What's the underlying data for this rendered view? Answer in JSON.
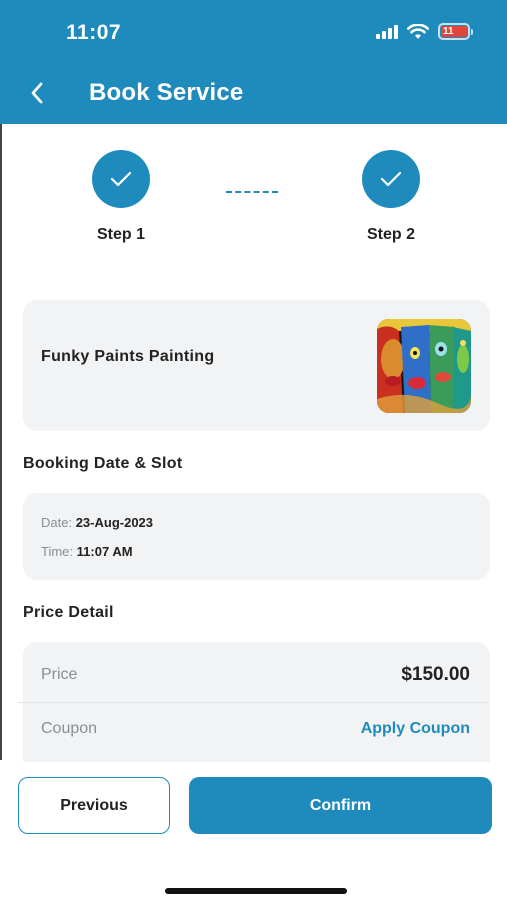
{
  "status_bar": {
    "time": "11:07",
    "battery_level": "11",
    "icons": [
      "signal-icon",
      "wifi-icon",
      "battery-icon"
    ]
  },
  "header": {
    "title": "Book Service",
    "back_icon": "chevron-left-icon"
  },
  "stepper": {
    "steps": [
      {
        "label": "Step 1",
        "state": "completed",
        "icon": "check-icon"
      },
      {
        "label": "Step 2",
        "state": "completed",
        "icon": "check-icon"
      }
    ]
  },
  "service": {
    "name": "Funky Paints Painting",
    "image": "abstract-painting-thumbnail"
  },
  "booking": {
    "section_title": "Booking Date & Slot",
    "date_label": "Date:",
    "date_value": "23-Aug-2023",
    "time_label": "Time:",
    "time_value": "11:07 AM"
  },
  "price_detail": {
    "section_title": "Price Detail",
    "price_label": "Price",
    "price_value": "$150.00",
    "coupon_label": "Coupon",
    "coupon_action": "Apply Coupon"
  },
  "footer": {
    "previous_label": "Previous",
    "confirm_label": "Confirm"
  },
  "colors": {
    "primary": "#1f8bbd",
    "card_background": "#f2f3f5",
    "muted_text": "#8a8d93"
  }
}
